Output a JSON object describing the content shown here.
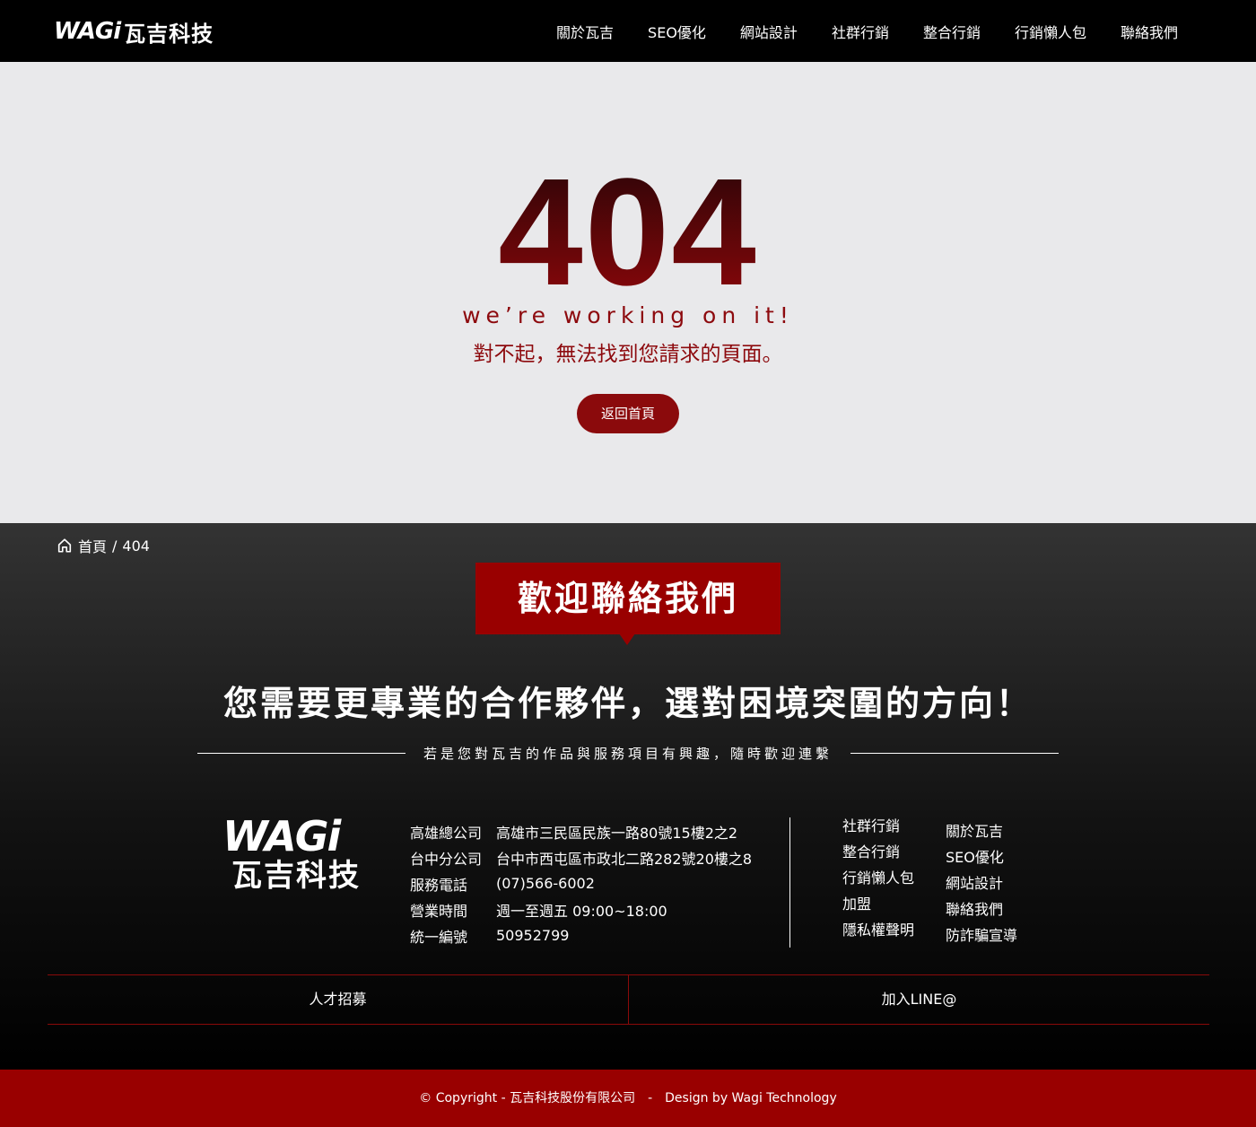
{
  "header": {
    "logo_mark": "WAGi",
    "logo_text": "瓦吉科技",
    "nav": [
      "關於瓦吉",
      "SEO優化",
      "網站設計",
      "社群行銷",
      "整合行銷",
      "行銷懶人包",
      "聯絡我們"
    ]
  },
  "hero": {
    "code": "404",
    "working": "we’re working on it!",
    "sorry": "對不起，無法找到您請求的頁面。",
    "home_button": "返回首頁"
  },
  "breadcrumb": {
    "home": "首頁",
    "separator": "/",
    "current": "404"
  },
  "contact": {
    "welcome": "歡迎聯絡我們",
    "headline": "您需要更專業的合作夥伴，選對困境突圍的方向！",
    "subline": "若是您對瓦吉的作品與服務項目有興趣，隨時歡迎連繫"
  },
  "footer": {
    "logo_mark": "WAGi",
    "logo_text": "瓦吉科技",
    "info": [
      {
        "k": "高雄總公司",
        "v": "高雄市三民區民族一路80號15樓2之2"
      },
      {
        "k": "台中分公司",
        "v": "台中市西屯區市政北二路282號20樓之8"
      },
      {
        "k": "服務電話",
        "v": "(07)566-6002"
      },
      {
        "k": "營業時間",
        "v": "週一至週五 09:00~18:00"
      },
      {
        "k": "統一編號",
        "v": "50952799"
      }
    ],
    "links_col1": [
      "社群行銷",
      "整合行銷",
      "行銷懶人包",
      "加盟",
      "隱私權聲明"
    ],
    "links_col2": [
      "關於瓦吉",
      "SEO優化",
      "網站設計",
      "聯絡我們",
      "防詐騙宣導"
    ],
    "bottom_left": "人才招募",
    "bottom_right": "加入LINE@",
    "copyright": "© Copyright - 瓦吉科技股份有限公司",
    "design": "Design by Wagi Technology",
    "dash": "-"
  },
  "colors": {
    "brand_red": "#990000",
    "hero_bg": "#e9e9eb",
    "text_red": "#8d0a0e"
  },
  "icons": {
    "breadcrumb": "home-icon"
  }
}
